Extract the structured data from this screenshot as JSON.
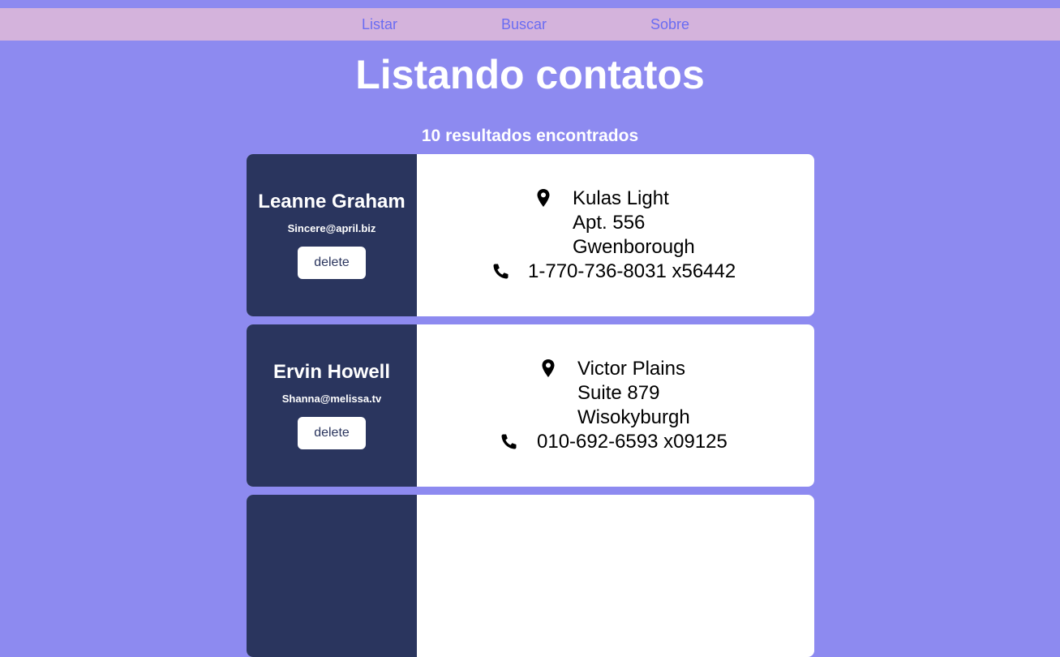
{
  "nav": {
    "items": [
      "Listar",
      "Buscar",
      "Sobre"
    ]
  },
  "page": {
    "title": "Listando contatos",
    "results": "10 resultados encontrados"
  },
  "contacts": [
    {
      "name": "Leanne Graham",
      "email": "Sincere@april.biz",
      "delete_label": "delete",
      "address": [
        "Kulas Light",
        "Apt. 556",
        "Gwenborough"
      ],
      "phone": "1-770-736-8031 x56442"
    },
    {
      "name": "Ervin Howell",
      "email": "Shanna@melissa.tv",
      "delete_label": "delete",
      "address": [
        "Victor Plains",
        "Suite 879",
        "Wisokyburgh"
      ],
      "phone": "010-692-6593 x09125"
    },
    {
      "name": "",
      "email": "",
      "delete_label": "",
      "address": [
        "",
        "",
        ""
      ],
      "phone": ""
    }
  ],
  "icons": {
    "address": "map-pin-icon",
    "phone": "phone-icon"
  },
  "colors": {
    "background": "#8d8af0",
    "nav_bar": "#d4b3dc",
    "nav_link": "#6a6cf2",
    "card_left": "#2a355e",
    "card_right": "#ffffff"
  }
}
